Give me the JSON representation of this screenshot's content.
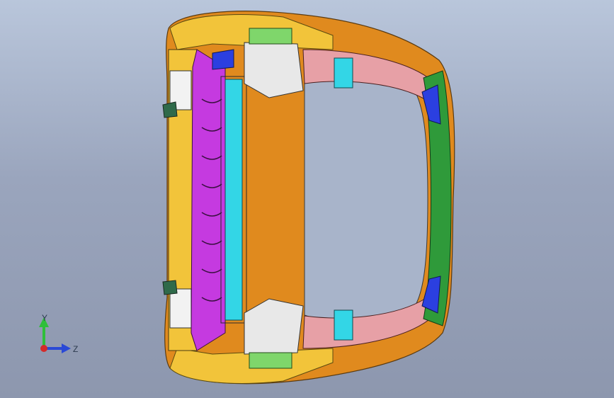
{
  "viewport": {
    "background_top": "#b9c6db",
    "background_bottom": "#8d97ae"
  },
  "model": {
    "icon": "car-body-frame-model",
    "colors": {
      "magenta": "#c53ae0",
      "cyan": "#33d6e6",
      "orange": "#e08a1e",
      "yellow": "#f2c43a",
      "green": "#2f9a3a",
      "pink": "#e7a0a6",
      "blue": "#2b3fe0",
      "lightgreen": "#7fd66b",
      "white": "#f2f2f2"
    }
  },
  "triad": {
    "icon": "view-orientation-triad-icon",
    "y_label": "Y",
    "z_label": "Z",
    "y_color": "#2fbf3a",
    "z_color": "#2a49d6",
    "x_color": "#d42a2a"
  }
}
